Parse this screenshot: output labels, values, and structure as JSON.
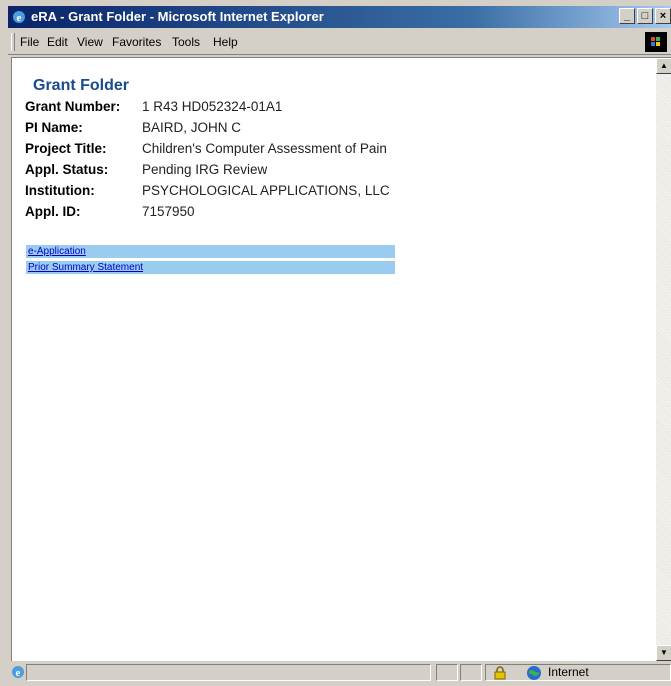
{
  "window": {
    "title": "eRA - Grant Folder - Microsoft Internet Explorer"
  },
  "menu": [
    "File",
    "Edit",
    "View",
    "Favorites",
    "Tools",
    "Help"
  ],
  "page": {
    "heading": "Grant Folder",
    "fields": [
      {
        "label": "Grant Number:",
        "value": "1 R43 HD052324-01A1"
      },
      {
        "label": "PI Name:",
        "value": "BAIRD, JOHN C"
      },
      {
        "label": "Project Title:",
        "value": "Children's Computer Assessment of Pain"
      },
      {
        "label": "Appl. Status:",
        "value": "Pending IRG Review"
      },
      {
        "label": "Institution:",
        "value": "PSYCHOLOGICAL APPLICATIONS, LLC"
      },
      {
        "label": "Appl. ID:",
        "value": "7157950"
      }
    ],
    "links": [
      "e-Application",
      "Prior Summary Statement"
    ]
  },
  "status": {
    "zone": "Internet"
  },
  "icons": {
    "app": "ie-icon",
    "throbber": "windows-logo-icon",
    "lock": "lock-icon",
    "zone": "globe-icon"
  }
}
